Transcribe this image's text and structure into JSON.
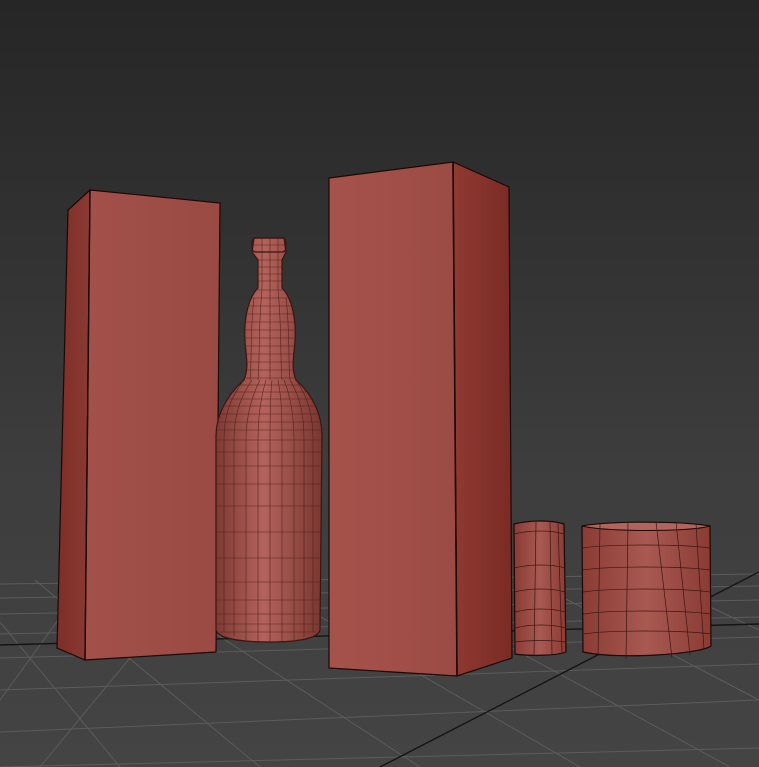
{
  "viewport": {
    "background_color": "#363636",
    "grid_color": "#5a5a5a",
    "grid_major_color": "#111111"
  },
  "scene": {
    "material_color": "#9c4a42",
    "wire_color": "#3a1512",
    "edge_color": "#1a0806",
    "objects": [
      {
        "name": "box-left",
        "kind": "box"
      },
      {
        "name": "bottle",
        "kind": "bottle"
      },
      {
        "name": "box-center",
        "kind": "box"
      },
      {
        "name": "glass-small",
        "kind": "glass"
      },
      {
        "name": "glass-large",
        "kind": "glass"
      }
    ]
  }
}
